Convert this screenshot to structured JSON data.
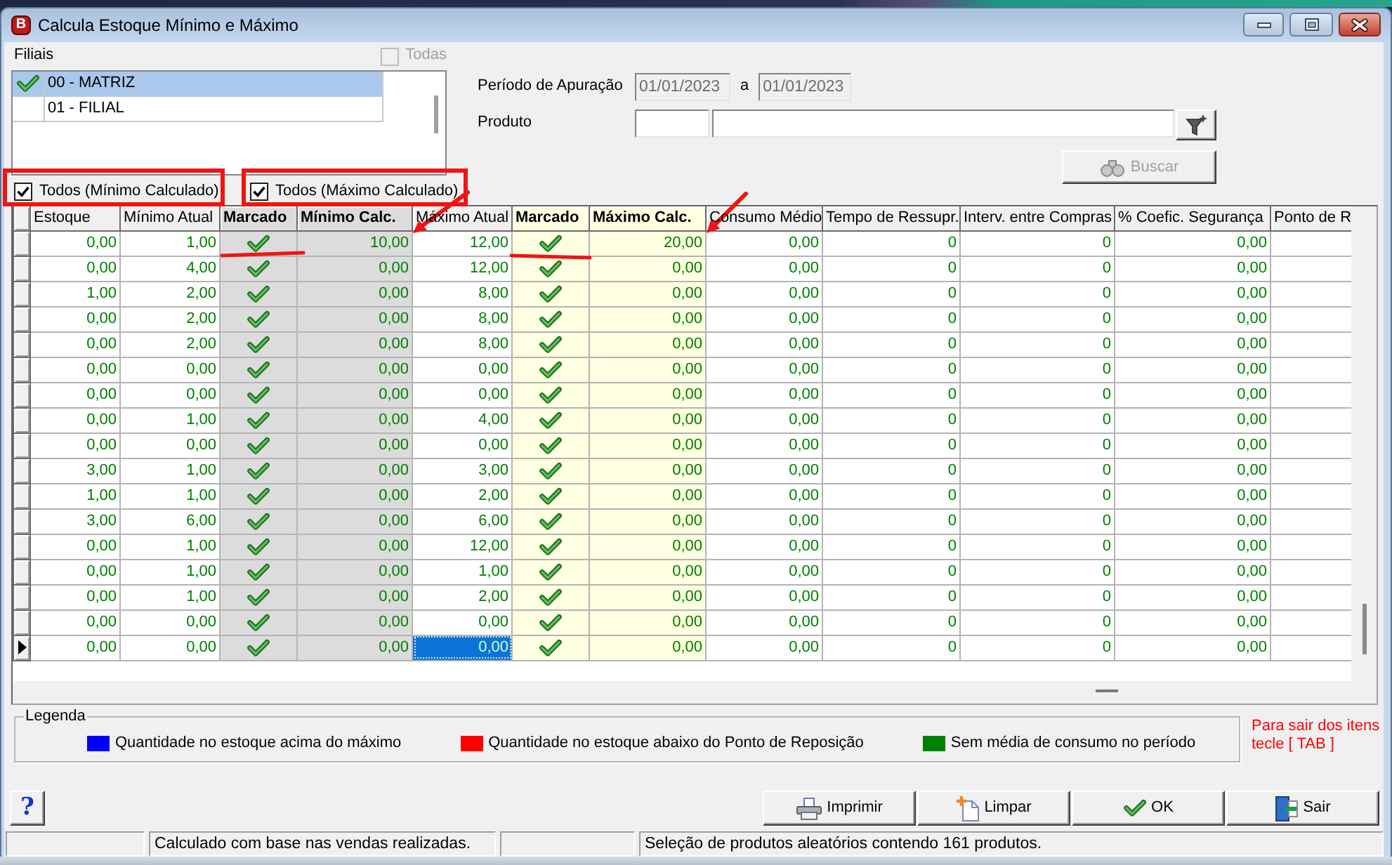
{
  "window": {
    "app_badge": "B",
    "title": "Calcula Estoque Mínimo e Máximo"
  },
  "branches": {
    "label": "Filiais",
    "select_all": {
      "label": "Todas",
      "checked": false,
      "disabled": true
    },
    "items": [
      {
        "label": "00 - MATRIZ",
        "checked": true,
        "selected": true
      },
      {
        "label": "01 - FILIAL",
        "checked": false,
        "selected": false
      }
    ]
  },
  "filters": {
    "period_label": "Período de Apuração",
    "period_from": "01/01/2023",
    "period_separator": "a",
    "period_to": "01/01/2023",
    "dates_disabled": true,
    "product_label": "Produto"
  },
  "search_button": {
    "label": "Buscar",
    "disabled": true
  },
  "mark_all": [
    {
      "label": "Todos (Mínimo Calculado)",
      "checked": true
    },
    {
      "label": "Todos (Máximo Calculado)",
      "checked": true
    }
  ],
  "table": {
    "columns": [
      {
        "label": "Estoque",
        "kind": "number",
        "emphasized": false,
        "selected": false
      },
      {
        "label": "Mínimo Atual",
        "kind": "number",
        "emphasized": false,
        "selected": false
      },
      {
        "label": "Marcado",
        "kind": "check",
        "emphasized": true,
        "color": "#dcdcdc",
        "selected": false
      },
      {
        "label": "Mínimo Calc.",
        "kind": "number",
        "emphasized": true,
        "color": "#dcdcdc",
        "selected": false
      },
      {
        "label": "Máximo Atual",
        "kind": "number",
        "emphasized": false,
        "selected": true
      },
      {
        "label": "Marcado",
        "kind": "check",
        "emphasized": true,
        "color": "#ffffe1",
        "selected": false
      },
      {
        "label": "Máximo Calc.",
        "kind": "number",
        "emphasized": true,
        "color": "#ffffe1",
        "selected": false
      },
      {
        "label": "Consumo Médio",
        "kind": "number",
        "emphasized": false,
        "selected": false
      },
      {
        "label": "Tempo de Ressupr.",
        "kind": "number",
        "emphasized": false,
        "selected": false
      },
      {
        "label": "Interv. entre Compras",
        "kind": "number",
        "emphasized": false,
        "selected": false
      },
      {
        "label": "% Coefic. Segurança",
        "kind": "number",
        "emphasized": false,
        "selected": false
      },
      {
        "label": "Ponto de R",
        "kind": "number",
        "emphasized": false,
        "selected": false
      }
    ],
    "rows": [
      {
        "selected": false,
        "cells": [
          "0,00",
          "1,00",
          true,
          "10,00",
          "12,00",
          true,
          "20,00",
          "0,00",
          "0",
          "0",
          "0,00"
        ]
      },
      {
        "selected": false,
        "cells": [
          "0,00",
          "4,00",
          true,
          "0,00",
          "12,00",
          true,
          "0,00",
          "0,00",
          "0",
          "0",
          "0,00"
        ]
      },
      {
        "selected": false,
        "cells": [
          "1,00",
          "2,00",
          true,
          "0,00",
          "8,00",
          true,
          "0,00",
          "0,00",
          "0",
          "0",
          "0,00"
        ]
      },
      {
        "selected": false,
        "cells": [
          "0,00",
          "2,00",
          true,
          "0,00",
          "8,00",
          true,
          "0,00",
          "0,00",
          "0",
          "0",
          "0,00"
        ]
      },
      {
        "selected": false,
        "cells": [
          "0,00",
          "2,00",
          true,
          "0,00",
          "8,00",
          true,
          "0,00",
          "0,00",
          "0",
          "0",
          "0,00"
        ]
      },
      {
        "selected": false,
        "cells": [
          "0,00",
          "0,00",
          true,
          "0,00",
          "0,00",
          true,
          "0,00",
          "0,00",
          "0",
          "0",
          "0,00"
        ]
      },
      {
        "selected": false,
        "cells": [
          "0,00",
          "0,00",
          true,
          "0,00",
          "0,00",
          true,
          "0,00",
          "0,00",
          "0",
          "0",
          "0,00"
        ]
      },
      {
        "selected": false,
        "cells": [
          "0,00",
          "1,00",
          true,
          "0,00",
          "4,00",
          true,
          "0,00",
          "0,00",
          "0",
          "0",
          "0,00"
        ]
      },
      {
        "selected": false,
        "cells": [
          "0,00",
          "0,00",
          true,
          "0,00",
          "0,00",
          true,
          "0,00",
          "0,00",
          "0",
          "0",
          "0,00"
        ]
      },
      {
        "selected": false,
        "cells": [
          "3,00",
          "1,00",
          true,
          "0,00",
          "3,00",
          true,
          "0,00",
          "0,00",
          "0",
          "0",
          "0,00"
        ]
      },
      {
        "selected": false,
        "cells": [
          "1,00",
          "1,00",
          true,
          "0,00",
          "2,00",
          true,
          "0,00",
          "0,00",
          "0",
          "0",
          "0,00"
        ]
      },
      {
        "selected": false,
        "cells": [
          "3,00",
          "6,00",
          true,
          "0,00",
          "6,00",
          true,
          "0,00",
          "0,00",
          "0",
          "0",
          "0,00"
        ]
      },
      {
        "selected": false,
        "cells": [
          "0,00",
          "1,00",
          true,
          "0,00",
          "12,00",
          true,
          "0,00",
          "0,00",
          "0",
          "0",
          "0,00"
        ]
      },
      {
        "selected": false,
        "cells": [
          "0,00",
          "1,00",
          true,
          "0,00",
          "1,00",
          true,
          "0,00",
          "0,00",
          "0",
          "0",
          "0,00"
        ]
      },
      {
        "selected": false,
        "cells": [
          "0,00",
          "1,00",
          true,
          "0,00",
          "2,00",
          true,
          "0,00",
          "0,00",
          "0",
          "0",
          "0,00"
        ]
      },
      {
        "selected": false,
        "cells": [
          "0,00",
          "0,00",
          true,
          "0,00",
          "0,00",
          true,
          "0,00",
          "0,00",
          "0",
          "0",
          "0,00"
        ]
      },
      {
        "selected": true,
        "cells": [
          "0,00",
          "0,00",
          true,
          "0,00",
          "0,00",
          true,
          "0,00",
          "0,00",
          "0",
          "0",
          "0,00"
        ]
      }
    ]
  },
  "legend": {
    "title": "Legenda",
    "items": [
      {
        "label": "Quantidade no estoque acima do máximo",
        "color": "#0000ff"
      },
      {
        "label": "Quantidade no estoque abaixo do Ponto de Reposição",
        "color": "#ff0000"
      },
      {
        "label": "Sem média de consumo no período",
        "color": "#008000"
      }
    ]
  },
  "exit_hint": "Para sair dos itens tecle [ TAB ]",
  "help_button": {
    "label": "?"
  },
  "actions": [
    {
      "label": "Imprimir",
      "kind": "print"
    },
    {
      "label": "Limpar",
      "kind": "clear"
    },
    {
      "label": "OK",
      "kind": "ok"
    },
    {
      "label": "Sair",
      "kind": "exit"
    }
  ],
  "status_bar": [
    {
      "kind": "blank"
    },
    {
      "kind": "text",
      "text": "Calculado com base nas vendas realizadas."
    },
    {
      "kind": "blank"
    },
    {
      "kind": "text",
      "text": "Seleção de produtos aleatórios contendo 161 produtos."
    }
  ]
}
